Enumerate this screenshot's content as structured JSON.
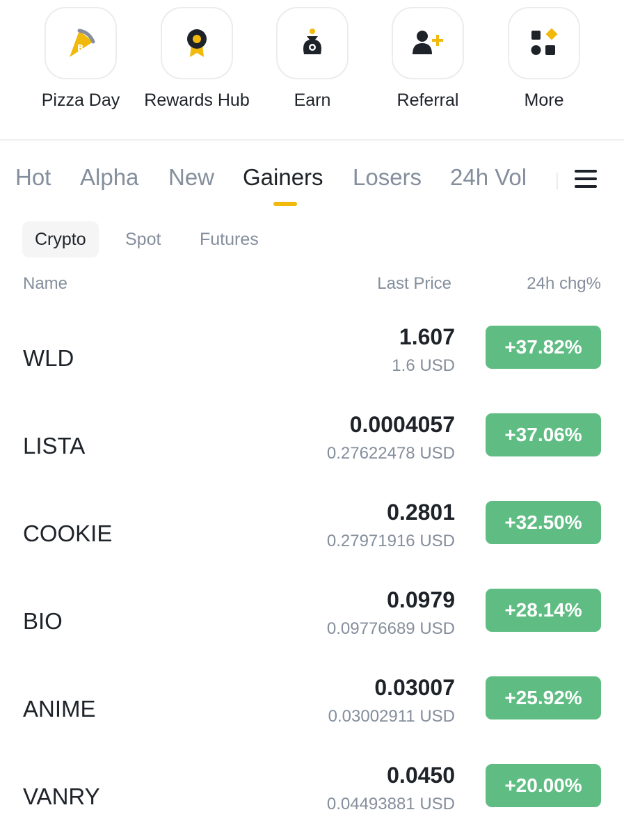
{
  "shortcuts": [
    {
      "label": "Pizza Day",
      "icon": "pizza-slice-icon"
    },
    {
      "label": "Rewards Hub",
      "icon": "medal-icon"
    },
    {
      "label": "Earn",
      "icon": "money-bag-icon"
    },
    {
      "label": "Referral",
      "icon": "add-user-icon"
    },
    {
      "label": "More",
      "icon": "grid-more-icon"
    }
  ],
  "tabs": [
    "Hot",
    "Alpha",
    "New",
    "Gainers",
    "Losers",
    "24h Vol"
  ],
  "active_tab": "Gainers",
  "subtabs": [
    "Crypto",
    "Spot",
    "Futures"
  ],
  "active_subtab": "Crypto",
  "columns": {
    "name": "Name",
    "price": "Last Price",
    "change": "24h chg%"
  },
  "rows": [
    {
      "symbol": "WLD",
      "price": "1.607",
      "usd": "1.6 USD",
      "change": "+37.82%"
    },
    {
      "symbol": "LISTA",
      "price": "0.0004057",
      "usd": "0.27622478 USD",
      "change": "+37.06%"
    },
    {
      "symbol": "COOKIE",
      "price": "0.2801",
      "usd": "0.27971916 USD",
      "change": "+32.50%"
    },
    {
      "symbol": "BIO",
      "price": "0.0979",
      "usd": "0.09776689 USD",
      "change": "+28.14%"
    },
    {
      "symbol": "ANIME",
      "price": "0.03007",
      "usd": "0.03002911 USD",
      "change": "+25.92%"
    },
    {
      "symbol": "VANRY",
      "price": "0.0450",
      "usd": "0.04493881 USD",
      "change": "+20.00%"
    }
  ],
  "colors": {
    "accent": "#f0b90b",
    "gain": "#5fbd83",
    "text": "#1e2329",
    "muted": "#848e9c"
  }
}
